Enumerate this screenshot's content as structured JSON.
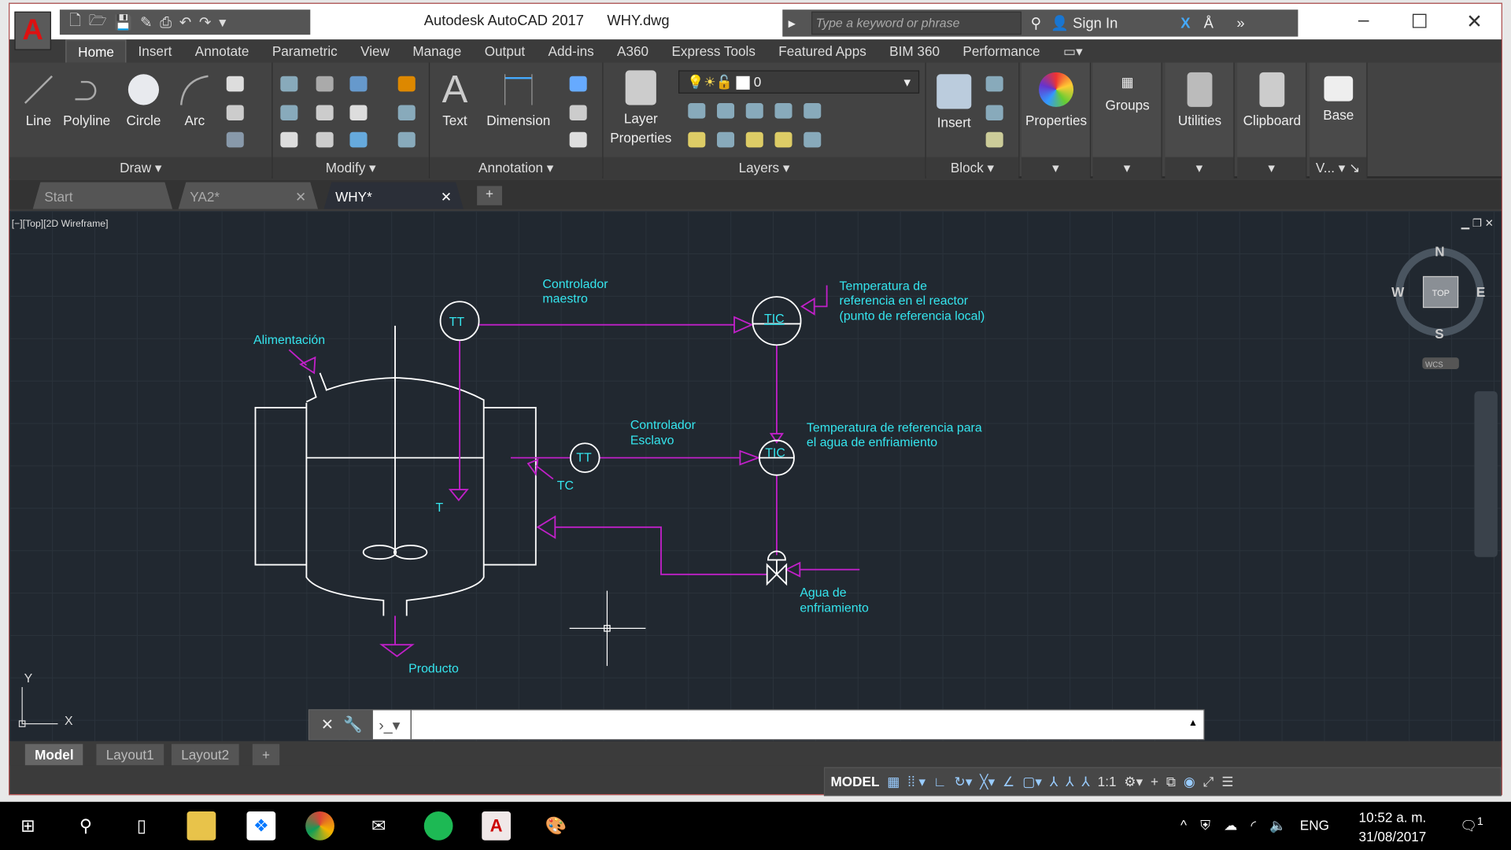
{
  "titlebar": {
    "app": "Autodesk AutoCAD 2017",
    "file": "WHY.dwg",
    "search_placeholder": "Type a keyword or phrase",
    "sign_in": "Sign In",
    "logo": "A"
  },
  "ribbon_tabs": [
    "Home",
    "Insert",
    "Annotate",
    "Parametric",
    "View",
    "Manage",
    "Output",
    "Add-ins",
    "A360",
    "Express Tools",
    "Featured Apps",
    "BIM 360",
    "Performance"
  ],
  "ribbon": {
    "draw": {
      "title": "Draw",
      "tools": [
        "Line",
        "Polyline",
        "Circle",
        "Arc"
      ]
    },
    "modify": {
      "title": "Modify"
    },
    "annotation": {
      "title": "Annotation",
      "tools": [
        "Text",
        "Dimension"
      ]
    },
    "layers": {
      "title": "Layers",
      "layer_props": "Layer Properties",
      "current_layer": "0"
    },
    "block": {
      "title": "Block",
      "insert": "Insert"
    },
    "properties": "Properties",
    "groups": "Groups",
    "utilities": "Utilities",
    "clipboard": "Clipboard",
    "base": "Base",
    "view": "V..."
  },
  "doc_tabs": [
    {
      "label": "Start"
    },
    {
      "label": "YA2*"
    },
    {
      "label": "WHY*"
    }
  ],
  "viewport": {
    "label": "[−][Top][2D Wireframe]",
    "viewcube": {
      "n": "N",
      "s": "S",
      "e": "E",
      "w": "W",
      "top": "TOP",
      "wcs": "WCS"
    }
  },
  "drawing": {
    "alimentacion": "Alimentación",
    "controlador_maestro": [
      "Controlador",
      "maestro"
    ],
    "tt1": "TT",
    "tic1": "TIC",
    "temp_ref_reactor": [
      "Temperatura de",
      "referencia en el reactor",
      "(punto de referencia local)"
    ],
    "controlador_esclavo": [
      "Controlador",
      "Esclavo"
    ],
    "tt2": "TT",
    "tic2": "TIC",
    "temp_ref_agua": [
      "Temperatura de referencia para",
      "el agua de enfriamiento"
    ],
    "tc": "TC",
    "t": "T",
    "agua": [
      "Agua de",
      "enfriamiento"
    ],
    "producto": "Producto",
    "ucs_x": "X",
    "ucs_y": "Y"
  },
  "layout_tabs": [
    "Model",
    "Layout1",
    "Layout2",
    "+"
  ],
  "status": {
    "model": "MODEL",
    "scale": "1:1"
  },
  "taskbar": {
    "lang": "ENG",
    "time": "10:52 a. m.",
    "date": "31/08/2017",
    "notifications": "1"
  },
  "colors": {
    "annotation": "#35e5ee",
    "instrument_lines": "#c020c8",
    "equipment": "#ffffff",
    "canvas": "#212830"
  }
}
